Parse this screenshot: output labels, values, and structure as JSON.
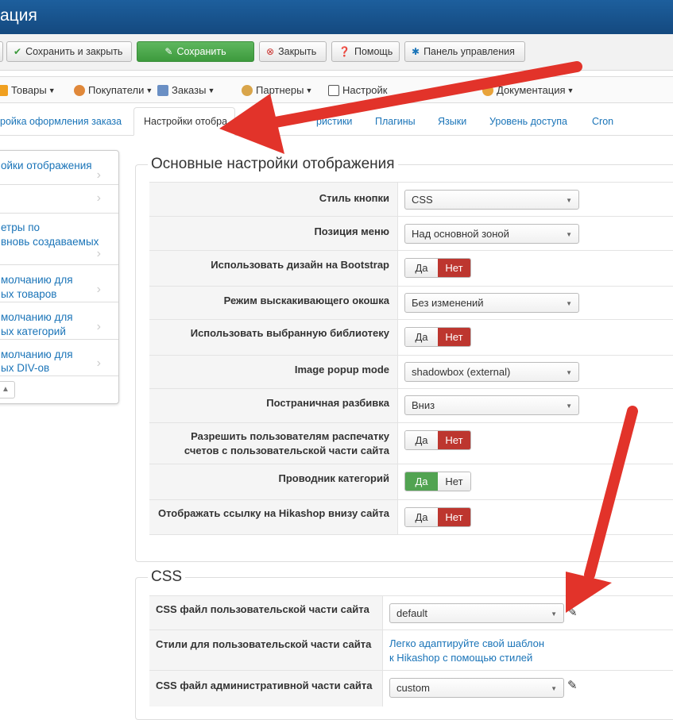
{
  "header": {
    "title": "ация"
  },
  "toolbar": {
    "save_close": "Сохранить и закрыть",
    "save": "Сохранить",
    "close": "Закрыть",
    "help": "Помощь",
    "control_panel": "Панель управления"
  },
  "menu": [
    {
      "label": "Товары"
    },
    {
      "label": "Покупатели"
    },
    {
      "label": "Заказы"
    },
    {
      "label": "Партнеры"
    },
    {
      "label": "Настройк"
    },
    {
      "label": "Документация"
    }
  ],
  "tabs": {
    "checkout": "ройка оформления заказа",
    "display": "Настройки отобра",
    "features": "ристики",
    "plugins": "Плагины",
    "languages": "Языки",
    "access": "Уровень доступа",
    "cron": "Cron"
  },
  "sidenav": {
    "items": [
      {
        "line1": "ойки отображения",
        "line2": ""
      },
      {
        "line1": "",
        "line2": ""
      },
      {
        "line1": "етры по",
        "line2": "вновь создаваемых"
      },
      {
        "line1": "молчанию для",
        "line2": "ых товаров"
      },
      {
        "line1": "молчанию для",
        "line2": "ых категорий"
      },
      {
        "line1": "молчанию для",
        "line2": "ых DIV-ов"
      }
    ],
    "scroll_icon": "▲"
  },
  "display_settings": {
    "legend": "Основные настройки отображения",
    "rows": [
      {
        "label": "Стиль кнопки",
        "value": "CSS"
      },
      {
        "label": "Позиция меню",
        "value": "Над основной зоной"
      },
      {
        "label": "Использовать дизайн на Bootstrap",
        "yes": "Да",
        "no": "Нет",
        "selected": "no"
      },
      {
        "label": "Режим выскакивающего окошка",
        "value": "Без изменений"
      },
      {
        "label": "Использовать выбранную библиотеку",
        "yes": "Да",
        "no": "Нет",
        "selected": "no"
      },
      {
        "label": "Image popup mode",
        "value": "shadowbox (external)"
      },
      {
        "label": "Постраничная разбивка",
        "value": "Вниз"
      },
      {
        "label_line1": "Разрешить пользователям распечатку",
        "label_line2": "счетов с пользовательской части сайта",
        "yes": "Да",
        "no": "Нет",
        "selected": "no"
      },
      {
        "label": "Проводник категорий",
        "yes": "Да",
        "no": "Нет",
        "selected": "yes"
      },
      {
        "label": "Отображать ссылку на Hikashop внизу сайта",
        "yes": "Да",
        "no": "Нет",
        "selected": "no"
      }
    ]
  },
  "css_section": {
    "legend": "CSS",
    "frontend_css_label": "CSS файл пользовательской части сайта",
    "frontend_css_value": "default",
    "frontend_styles_label": "Стили для пользовательской части сайта",
    "frontend_styles_link_line1": "Легко адаптируйте свой шаблон",
    "frontend_styles_link_line2": "к Hikashop с помощью стилей",
    "backend_css_label": "CSS файл административной части сайта",
    "backend_css_value": "custom"
  },
  "colors": {
    "titlebar": "#1d5f9d",
    "link": "#1a74b8",
    "danger": "#bd362f",
    "success": "#51a351",
    "annotation_arrow": "#e2332a"
  }
}
